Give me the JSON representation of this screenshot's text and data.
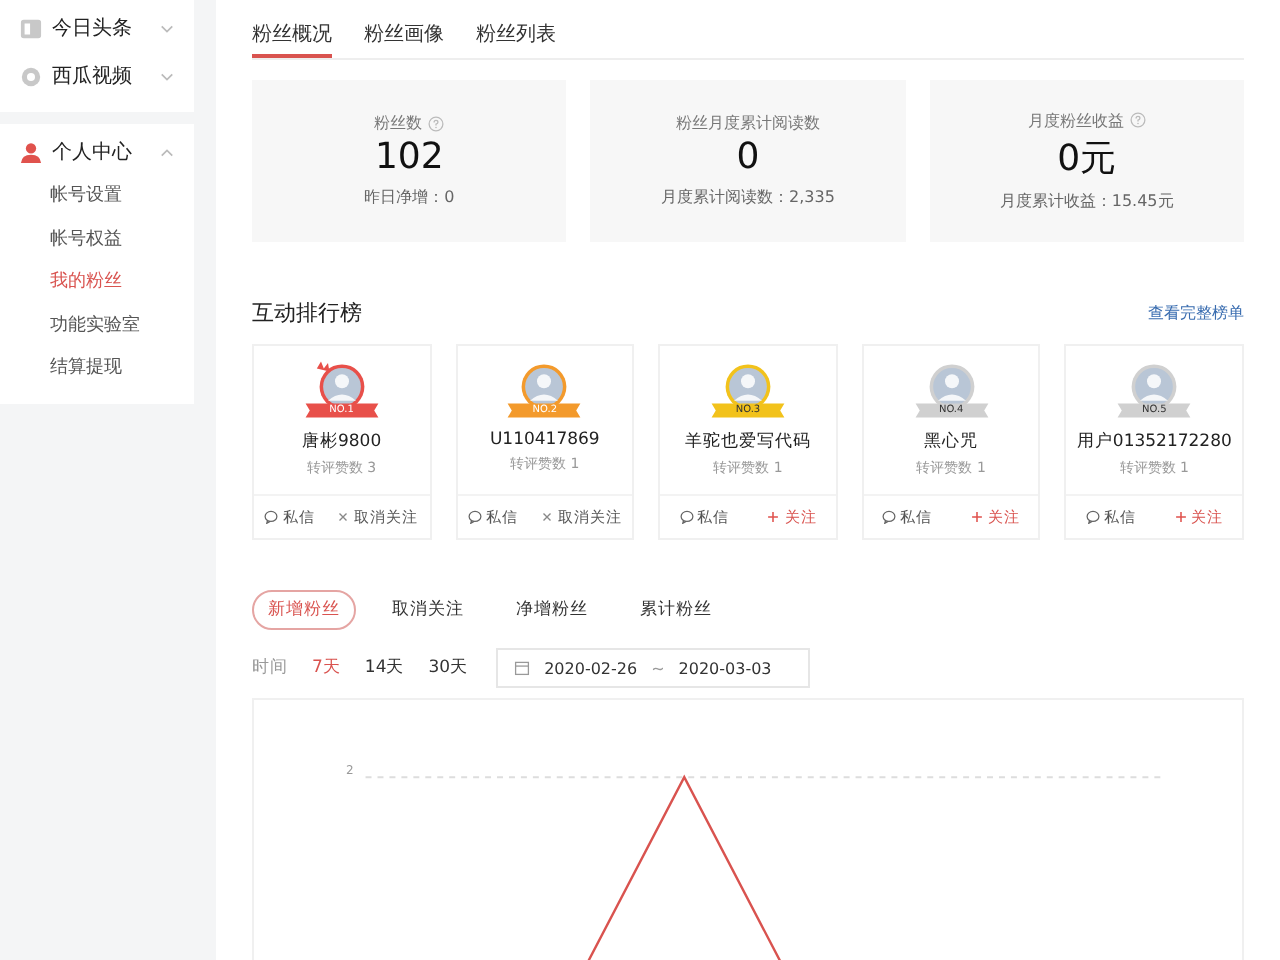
{
  "sidebar": {
    "groups": [
      {
        "items": [
          {
            "label": "今日头条",
            "expanded": false
          },
          {
            "label": "西瓜视频",
            "expanded": false
          }
        ]
      },
      {
        "items": [
          {
            "label": "个人中心",
            "expanded": true,
            "children": [
              {
                "label": "帐号设置",
                "selected": false
              },
              {
                "label": "帐号权益",
                "selected": false
              },
              {
                "label": "我的粉丝",
                "selected": true
              },
              {
                "label": "功能实验室",
                "selected": false
              },
              {
                "label": "结算提现",
                "selected": false
              }
            ]
          }
        ]
      }
    ]
  },
  "tabs": [
    {
      "label": "粉丝概况",
      "selected": true
    },
    {
      "label": "粉丝画像",
      "selected": false
    },
    {
      "label": "粉丝列表",
      "selected": false
    }
  ],
  "stats": [
    {
      "label": "粉丝数",
      "help": true,
      "value": "102",
      "sub": "昨日净增：0"
    },
    {
      "label": "粉丝月度累计阅读数",
      "help": false,
      "value": "0",
      "sub": "月度累计阅读数：2,335"
    },
    {
      "label": "月度粉丝收益",
      "help": true,
      "value": "0元",
      "sub": "月度累计收益：15.45元"
    }
  ],
  "ranking": {
    "title": "互动排行榜",
    "link": "查看完整榜单",
    "fans": [
      {
        "rank": "NO.1",
        "color": "#e8504a",
        "crown": true,
        "name": "唐彬9800",
        "count": "转评赞数 3",
        "message": "私信",
        "action": "取消关注",
        "following": true
      },
      {
        "rank": "NO.2",
        "color": "#f39a2c",
        "crown": false,
        "name": "U110417869",
        "count": "转评赞数 1",
        "message": "私信",
        "action": "取消关注",
        "following": true
      },
      {
        "rank": "NO.3",
        "color": "#f2c21b",
        "crown": false,
        "name": "羊驼也爱写代码",
        "count": "转评赞数 1",
        "message": "私信",
        "action": "关注",
        "following": false
      },
      {
        "rank": "NO.4",
        "color": "#d0d0d0",
        "crown": false,
        "name": "黑心咒",
        "count": "转评赞数 1",
        "message": "私信",
        "action": "关注",
        "following": false
      },
      {
        "rank": "NO.5",
        "color": "#d0d0d0",
        "crown": false,
        "name": "用户01352172280",
        "count": "转评赞数 1",
        "message": "私信",
        "action": "关注",
        "following": false
      }
    ]
  },
  "metric_tabs": [
    {
      "label": "新增粉丝",
      "selected": true
    },
    {
      "label": "取消关注",
      "selected": false
    },
    {
      "label": "净增粉丝",
      "selected": false
    },
    {
      "label": "累计粉丝",
      "selected": false
    }
  ],
  "time_filter": {
    "label": "时间",
    "options": [
      {
        "label": "7天",
        "selected": true
      },
      {
        "label": "14天",
        "selected": false
      },
      {
        "label": "30天",
        "selected": false
      }
    ],
    "date_from": "2020-02-26",
    "separator": "~",
    "date_to": "2020-03-03"
  },
  "chart": {
    "tick_label": "2"
  }
}
